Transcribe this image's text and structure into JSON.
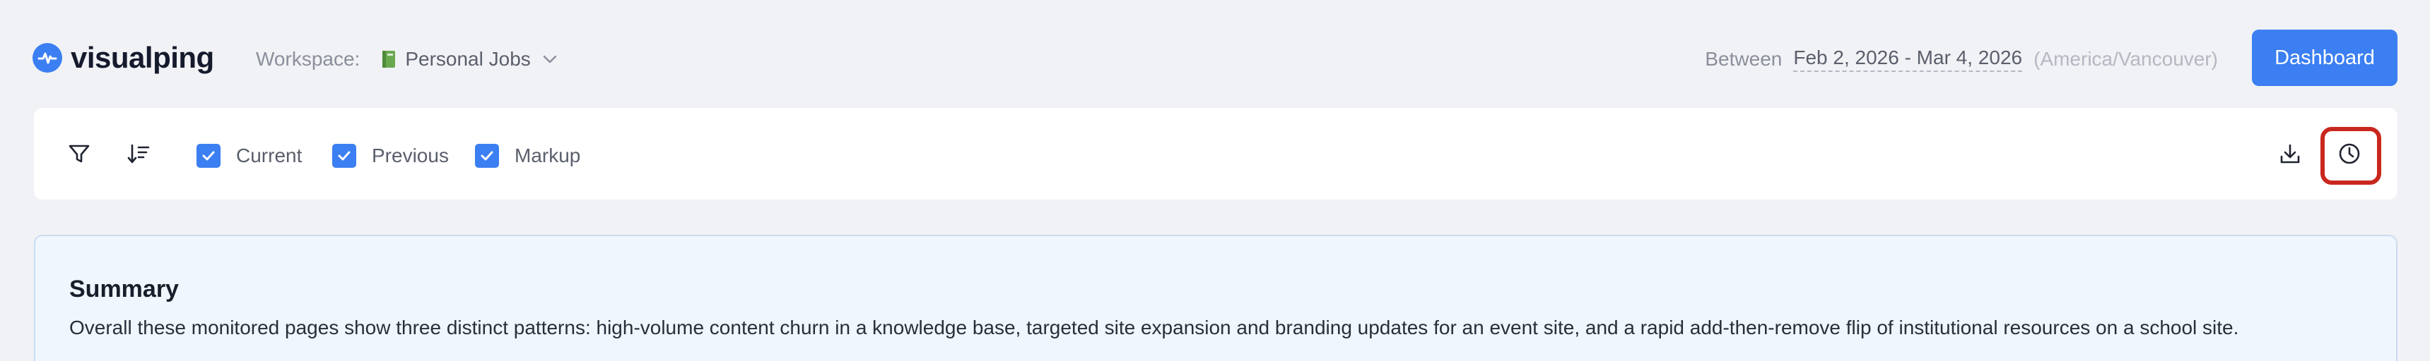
{
  "brand": {
    "name": "visualping"
  },
  "workspace": {
    "label": "Workspace:",
    "name": "Personal Jobs"
  },
  "date_range": {
    "label": "Between",
    "value": "Feb 2, 2026 - Mar 4, 2026",
    "timezone": "(America/Vancouver)"
  },
  "header": {
    "dashboard_label": "Dashboard"
  },
  "toolbar": {
    "checkboxes": [
      {
        "label": "Current",
        "checked": true
      },
      {
        "label": "Previous",
        "checked": true
      },
      {
        "label": "Markup",
        "checked": true
      }
    ],
    "icons": [
      "filter-icon",
      "sort-icon",
      "download-icon",
      "history-icon"
    ]
  },
  "summary": {
    "title": "Summary",
    "text": "Overall these monitored pages show three distinct patterns: high-volume content churn in a knowledge base, targeted site expansion and branding updates for an event site, and a rapid add-then-remove flip of institutional resources on a school site."
  },
  "colors": {
    "accent": "#3b7ff2",
    "highlight": "#c9271e",
    "summary_bg": "#eff6fd"
  }
}
